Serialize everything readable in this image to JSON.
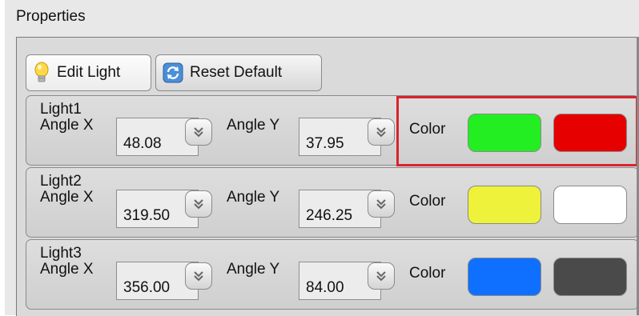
{
  "panel": {
    "title": "Properties"
  },
  "toolbar": {
    "edit_label": "Edit Light",
    "reset_label": "Reset Default"
  },
  "lights": [
    {
      "name": "Light1",
      "angle_x_label": "Angle X",
      "angle_x": "48.08",
      "angle_y_label": "Angle Y",
      "angle_y": "37.95",
      "color_label": "Color",
      "color_a": "#22ee22",
      "color_b": "#e60000"
    },
    {
      "name": "Light2",
      "angle_x_label": "Angle X",
      "angle_x": "319.50",
      "angle_y_label": "Angle Y",
      "angle_y": "246.25",
      "color_label": "Color",
      "color_a": "#eef23a",
      "color_b": "#ffffff"
    },
    {
      "name": "Light3",
      "angle_x_label": "Angle X",
      "angle_x": "356.00",
      "angle_y_label": "Angle Y",
      "angle_y": "84.00",
      "color_label": "Color",
      "color_a": "#0f70ff",
      "color_b": "#4a4a4a"
    }
  ],
  "icons": {
    "edit": "lightbulb-icon",
    "reset": "refresh-icon",
    "spinner": "double-chevron-down-icon"
  },
  "accent": {
    "highlight": "#d9232d"
  }
}
